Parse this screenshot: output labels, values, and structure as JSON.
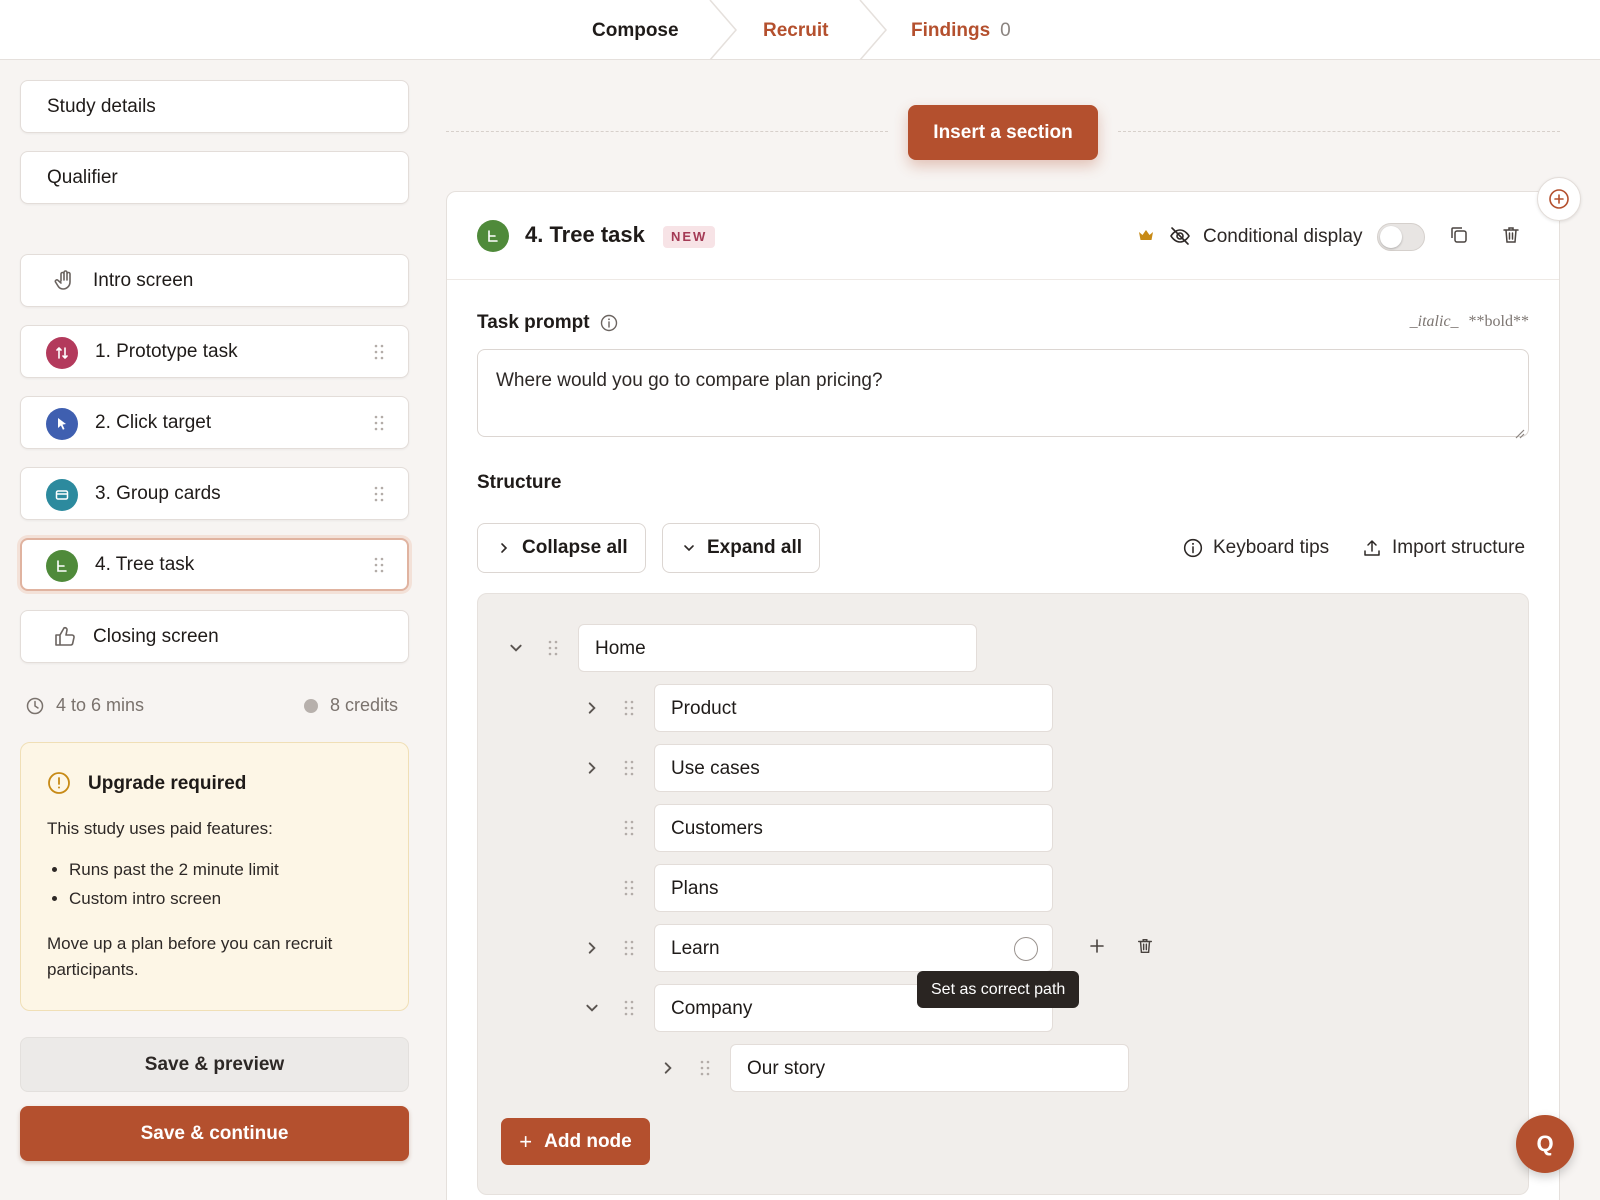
{
  "nav": {
    "tabs": [
      {
        "label": "Compose"
      },
      {
        "label": "Recruit"
      },
      {
        "label": "Findings",
        "count": "0"
      }
    ]
  },
  "sidebar": {
    "study_details": "Study details",
    "qualifier": "Qualifier",
    "intro": "Intro screen",
    "tasks": [
      {
        "label": "1. Prototype task",
        "color": "#b33a5c",
        "icon": "prototype-icon"
      },
      {
        "label": "2. Click target",
        "color": "#3f5fb0",
        "icon": "cursor-icon"
      },
      {
        "label": "3. Group cards",
        "color": "#2c8a9e",
        "icon": "cards-icon"
      },
      {
        "label": "4. Tree task",
        "color": "#4f8a3a",
        "icon": "tree-icon"
      }
    ],
    "closing": "Closing screen",
    "duration": "4 to 6 mins",
    "credits": "8 credits",
    "upgrade": {
      "title": "Upgrade required",
      "body": "This study uses paid features:",
      "items": [
        "Runs past the 2 minute limit",
        "Custom intro screen"
      ],
      "footer": "Move up a plan before you can recruit participants."
    },
    "save_preview": "Save & preview",
    "save_continue": "Save & continue"
  },
  "main": {
    "insert_section": "Insert a section",
    "task": {
      "title": "4. Tree task",
      "badge": "NEW",
      "conditional_display": "Conditional display",
      "conditional_on": false,
      "prompt_label": "Task prompt",
      "format_italic": "_italic_",
      "format_bold": "**bold**",
      "prompt_value": "Where would you go to compare plan pricing?",
      "structure_label": "Structure",
      "collapse_all": "Collapse all",
      "expand_all": "Expand all",
      "keyboard_tips": "Keyboard tips",
      "import_structure": "Import structure",
      "tree": [
        {
          "label": "Home"
        },
        {
          "label": "Product"
        },
        {
          "label": "Use cases"
        },
        {
          "label": "Customers"
        },
        {
          "label": "Plans"
        },
        {
          "label": "Learn"
        },
        {
          "label": "Company"
        },
        {
          "label": "Our story"
        }
      ],
      "tooltip": "Set as correct path",
      "add_node": "Add node"
    },
    "help_button": "Q"
  },
  "colors": {
    "accent": "#b4502e",
    "accent_text": "#b4502e"
  }
}
